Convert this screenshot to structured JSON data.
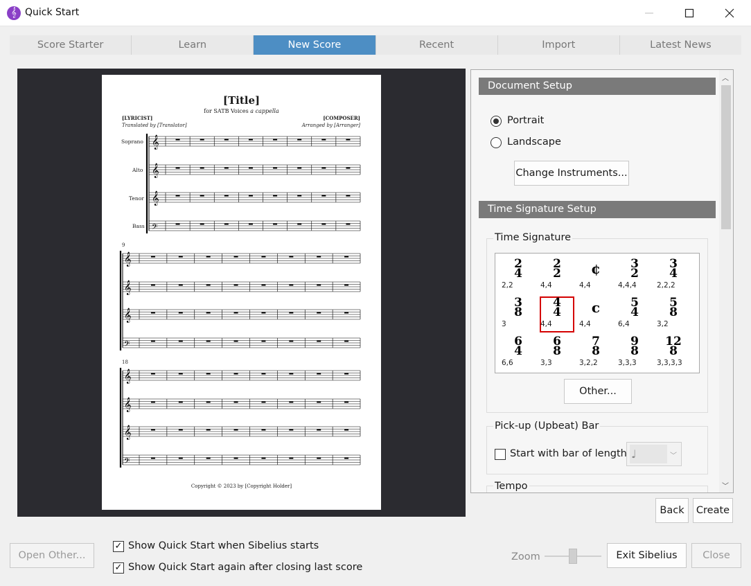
{
  "window": {
    "title": "Quick Start",
    "app_icon": "sibelius-logo-icon"
  },
  "tabs": [
    {
      "label": "Score Starter",
      "active": false
    },
    {
      "label": "Learn",
      "active": false
    },
    {
      "label": "New Score",
      "active": true
    },
    {
      "label": "Recent",
      "active": false
    },
    {
      "label": "Import",
      "active": false
    },
    {
      "label": "Latest News",
      "active": false
    }
  ],
  "score": {
    "title": "[Title]",
    "subtitle": "for SATB Voices",
    "subtitle_italic": "a cappella",
    "lyricist": "[LYRICIST]",
    "translator": "Translated by [Translator]",
    "composer": "[COMPOSER]",
    "arranger": "Arranged by [Arranger]",
    "staves": [
      "Soprano",
      "Alto",
      "Tenor",
      "Bass"
    ],
    "system2_bar": "9",
    "system3_bar": "18",
    "copyright": "Copyright © 2023 by [Copyright Holder]"
  },
  "document_setup": {
    "header": "Document Setup",
    "portrait": "Portrait",
    "landscape": "Landscape",
    "orientation": "portrait",
    "change_instruments": "Change Instruments..."
  },
  "time_signature_setup": {
    "header": "Time Signature Setup",
    "group_label": "Time Signature",
    "signatures": [
      {
        "top": "2",
        "bottom": "4",
        "beam": "2,2"
      },
      {
        "top": "2",
        "bottom": "2",
        "beam": "4,4"
      },
      {
        "symbol": "¢",
        "beam": "4,4"
      },
      {
        "top": "3",
        "bottom": "2",
        "beam": "4,4,4"
      },
      {
        "top": "3",
        "bottom": "4",
        "beam": "2,2,2"
      },
      {
        "top": "3",
        "bottom": "8",
        "beam": "3"
      },
      {
        "top": "4",
        "bottom": "4",
        "beam": "4,4",
        "selected": true
      },
      {
        "symbol": "c",
        "beam": "4,4"
      },
      {
        "top": "5",
        "bottom": "4",
        "beam": "6,4"
      },
      {
        "top": "5",
        "bottom": "8",
        "beam": "3,2"
      },
      {
        "top": "6",
        "bottom": "4",
        "beam": "6,6"
      },
      {
        "top": "6",
        "bottom": "8",
        "beam": "3,3"
      },
      {
        "top": "7",
        "bottom": "8",
        "beam": "3,2,2"
      },
      {
        "top": "9",
        "bottom": "8",
        "beam": "3,3,3"
      },
      {
        "top": "12",
        "bottom": "8",
        "beam": "3,3,3,3"
      }
    ],
    "other_button": "Other..."
  },
  "pickup": {
    "group_label": "Pick-up (Upbeat) Bar",
    "checkbox_label": "Start with bar of length:",
    "checked": false,
    "note_value": "♩"
  },
  "tempo": {
    "group_label": "Tempo"
  },
  "buttons": {
    "back": "Back",
    "create": "Create",
    "open_other": "Open Other...",
    "exit": "Exit Sibelius",
    "close": "Close"
  },
  "options": {
    "show_on_start": "Show Quick Start when Sibelius starts",
    "show_on_start_checked": true,
    "show_after_close": "Show Quick Start again after closing last score",
    "show_after_close_checked": true
  },
  "zoom": {
    "label": "Zoom",
    "level": 0.5
  }
}
